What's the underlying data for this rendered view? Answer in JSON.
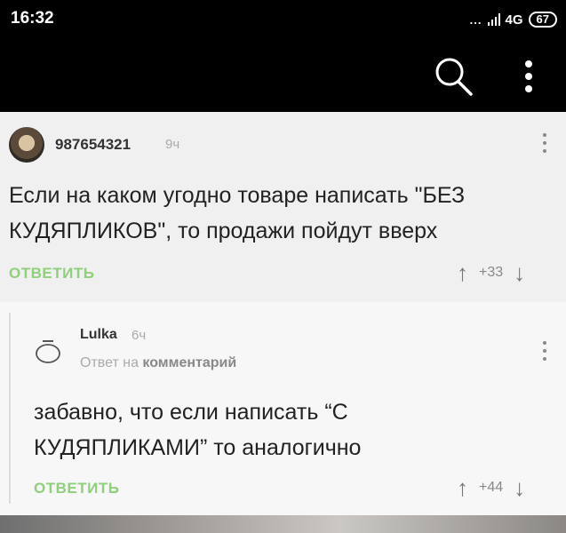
{
  "status_bar": {
    "time": "16:32",
    "dots": "...",
    "network": "4G",
    "battery": "67"
  },
  "toolbar": {
    "search_icon": "search-icon",
    "more_icon": "more-vert-icon"
  },
  "comments": [
    {
      "username": "987654321",
      "time": "9ч",
      "text_line1": "Если на каком угодно товаре написать \"БЕЗ",
      "text_line2": "КУДЯПЛИКОВ\", то продажи пойдут вверх",
      "reply_label": "ОТВЕТИТЬ",
      "rating": "+33"
    },
    {
      "username": "Lulka",
      "time": "6ч",
      "reply_to_prefix": "Ответ на",
      "reply_to_target": "комментарий",
      "text_line1": "забавно, что если написать “С",
      "text_line2": "КУДЯПЛИКАМИ” то аналогично",
      "reply_label": "ОТВЕТИТЬ",
      "rating": "+44"
    }
  ],
  "colors": {
    "accent_green": "#8fd07a",
    "header_bg": "#000000",
    "page_bg": "#f0f0f0"
  }
}
